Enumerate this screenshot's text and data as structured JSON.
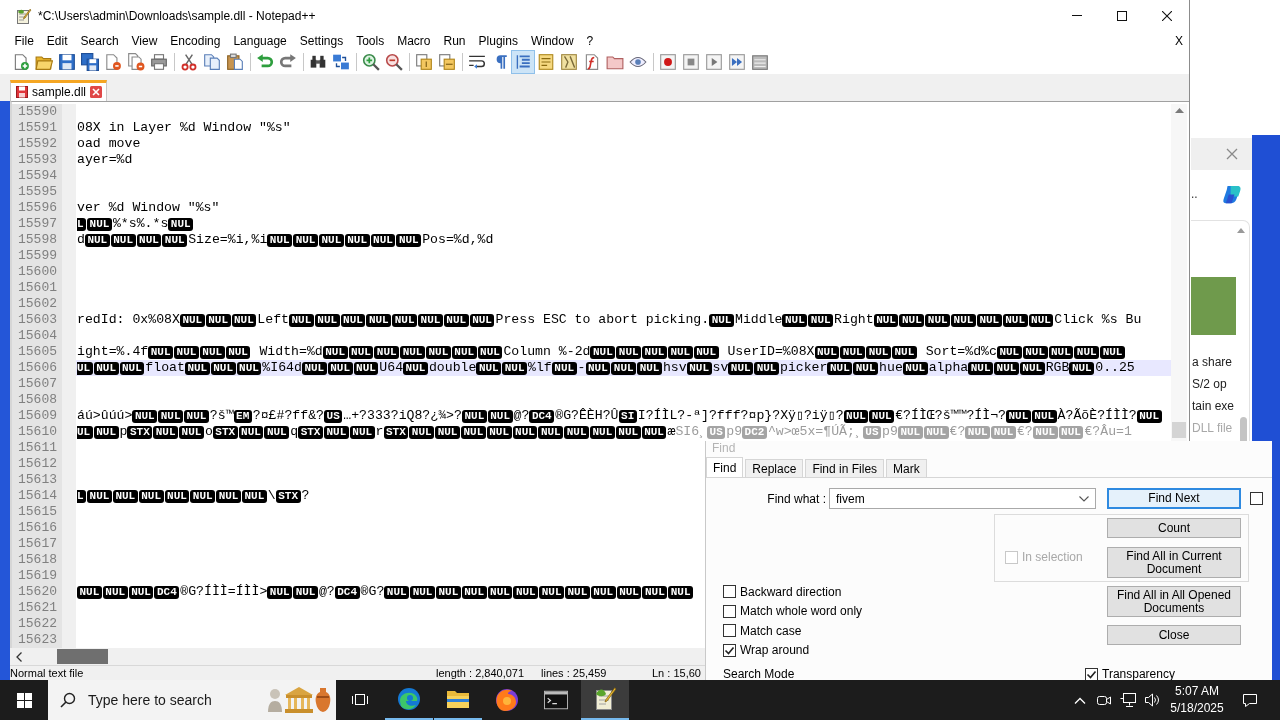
{
  "window": {
    "title": "*C:\\Users\\admin\\Downloads\\sample.dll - Notepad++"
  },
  "menu_bar": {
    "items": [
      "File",
      "Edit",
      "Search",
      "View",
      "Encoding",
      "Language",
      "Settings",
      "Tools",
      "Macro",
      "Run",
      "Plugins",
      "Window",
      "?"
    ],
    "close_label": "X"
  },
  "toolbar": [
    [
      {
        "pressed": false
      },
      {
        "pressed": false
      },
      {
        "pressed": false
      },
      {
        "pressed": false
      },
      {
        "pressed": false
      },
      {
        "pressed": false
      },
      {
        "pressed": false
      }
    ],
    [
      {
        "pressed": false
      },
      {
        "pressed": false
      },
      {
        "pressed": false
      }
    ],
    [
      {
        "pressed": false
      },
      {
        "pressed": false
      }
    ],
    [
      {
        "pressed": false
      },
      {
        "pressed": false
      }
    ],
    [
      {
        "pressed": false
      },
      {
        "pressed": false
      }
    ],
    [
      {
        "pressed": false
      },
      {
        "pressed": false
      }
    ],
    [
      {
        "pressed": false
      },
      {
        "pressed": false
      },
      {
        "pressed": true
      },
      {
        "pressed": false
      },
      {
        "pressed": false
      },
      {
        "pressed": false
      },
      {
        "pressed": false
      },
      {
        "pressed": false
      }
    ],
    [
      {
        "pressed": false
      },
      {
        "pressed": false
      },
      {
        "pressed": false
      },
      {
        "pressed": false
      },
      {
        "pressed": false
      }
    ]
  ],
  "tabs": [
    {
      "label": "sample.dll",
      "selected": true
    }
  ],
  "editor": {
    "lines": [
      {
        "number": "15590",
        "current": false
      },
      {
        "number": "15591",
        "current": false,
        "segments": [
          {
            "kind": "text",
            "text": "08X in Layer %d Window \"%s\""
          }
        ]
      },
      {
        "number": "15592",
        "current": false,
        "segments": [
          {
            "kind": "text",
            "text": "oad move"
          }
        ]
      },
      {
        "number": "15593",
        "current": false,
        "segments": [
          {
            "kind": "text",
            "text": "ayer=%d"
          }
        ]
      },
      {
        "number": "15594",
        "current": false
      },
      {
        "number": "15595",
        "current": false
      },
      {
        "number": "15596",
        "current": false,
        "segments": [
          {
            "kind": "text",
            "text": "ver %d Window \"%s\""
          }
        ]
      },
      {
        "number": "15597",
        "current": false,
        "segments": [
          {
            "kind": "ctrl-cut",
            "text": "L"
          },
          {
            "kind": "ctrl",
            "text": "NUL"
          },
          {
            "kind": "text",
            "text": "%*s%.*s"
          },
          {
            "kind": "ctrl",
            "text": "NUL"
          }
        ]
      },
      {
        "number": "15598",
        "current": false,
        "segments": [
          {
            "kind": "text",
            "text": "d"
          },
          {
            "kind": "ctrl",
            "text": "NUL"
          },
          {
            "kind": "ctrl",
            "text": "NUL"
          },
          {
            "kind": "ctrl",
            "text": "NUL"
          },
          {
            "kind": "ctrl",
            "text": "NUL"
          },
          {
            "kind": "text",
            "text": "Size=%i,%i"
          },
          {
            "kind": "ctrl",
            "text": "NUL"
          },
          {
            "kind": "ctrl",
            "text": "NUL"
          },
          {
            "kind": "ctrl",
            "text": "NUL"
          },
          {
            "kind": "ctrl",
            "text": "NUL"
          },
          {
            "kind": "ctrl",
            "text": "NUL"
          },
          {
            "kind": "ctrl",
            "text": "NUL"
          },
          {
            "kind": "text",
            "text": "Pos=%d,%d"
          }
        ]
      },
      {
        "number": "15599",
        "current": false
      },
      {
        "number": "15600",
        "current": false
      },
      {
        "number": "15601",
        "current": false
      },
      {
        "number": "15602",
        "current": false
      },
      {
        "number": "15603",
        "current": false,
        "segments": [
          {
            "kind": "text",
            "text": "redId: 0x%08X"
          },
          {
            "kind": "ctrl",
            "text": "NUL"
          },
          {
            "kind": "ctrl",
            "text": "NUL"
          },
          {
            "kind": "ctrl",
            "text": "NUL"
          },
          {
            "kind": "text",
            "text": "Left"
          },
          {
            "kind": "ctrl",
            "text": "NUL"
          },
          {
            "kind": "ctrl",
            "text": "NUL"
          },
          {
            "kind": "ctrl",
            "text": "NUL"
          },
          {
            "kind": "ctrl",
            "text": "NUL"
          },
          {
            "kind": "ctrl",
            "text": "NUL"
          },
          {
            "kind": "ctrl",
            "text": "NUL"
          },
          {
            "kind": "ctrl",
            "text": "NUL"
          },
          {
            "kind": "ctrl",
            "text": "NUL"
          },
          {
            "kind": "text",
            "text": "Press ESC to abort picking."
          },
          {
            "kind": "ctrl",
            "text": "NUL"
          },
          {
            "kind": "text",
            "text": "Middle"
          },
          {
            "kind": "ctrl",
            "text": "NUL"
          },
          {
            "kind": "ctrl",
            "text": "NUL"
          },
          {
            "kind": "text",
            "text": "Right"
          },
          {
            "kind": "ctrl",
            "text": "NUL"
          },
          {
            "kind": "ctrl",
            "text": "NUL"
          },
          {
            "kind": "ctrl",
            "text": "NUL"
          },
          {
            "kind": "ctrl",
            "text": "NUL"
          },
          {
            "kind": "ctrl",
            "text": "NUL"
          },
          {
            "kind": "ctrl",
            "text": "NUL"
          },
          {
            "kind": "ctrl",
            "text": "NUL"
          },
          {
            "kind": "text",
            "text": "Click %s Bu"
          }
        ]
      },
      {
        "number": "15604",
        "current": false
      },
      {
        "number": "15605",
        "current": false,
        "segments": [
          {
            "kind": "text",
            "text": "ight=%.4f"
          },
          {
            "kind": "ctrl",
            "text": "NUL"
          },
          {
            "kind": "ctrl",
            "text": "NUL"
          },
          {
            "kind": "ctrl",
            "text": "NUL"
          },
          {
            "kind": "ctrl",
            "text": "NUL"
          },
          {
            "kind": "text",
            "text": " Width=%d"
          },
          {
            "kind": "ctrl",
            "text": "NUL"
          },
          {
            "kind": "ctrl",
            "text": "NUL"
          },
          {
            "kind": "ctrl",
            "text": "NUL"
          },
          {
            "kind": "ctrl",
            "text": "NUL"
          },
          {
            "kind": "ctrl",
            "text": "NUL"
          },
          {
            "kind": "ctrl",
            "text": "NUL"
          },
          {
            "kind": "ctrl",
            "text": "NUL"
          },
          {
            "kind": "text",
            "text": "Column %-2d"
          },
          {
            "kind": "ctrl",
            "text": "NUL"
          },
          {
            "kind": "ctrl",
            "text": "NUL"
          },
          {
            "kind": "ctrl",
            "text": "NUL"
          },
          {
            "kind": "ctrl",
            "text": "NUL"
          },
          {
            "kind": "ctrl",
            "text": "NUL"
          },
          {
            "kind": "text",
            "text": " UserID=%08X"
          },
          {
            "kind": "ctrl",
            "text": "NUL"
          },
          {
            "kind": "ctrl",
            "text": "NUL"
          },
          {
            "kind": "ctrl",
            "text": "NUL"
          },
          {
            "kind": "ctrl",
            "text": "NUL"
          },
          {
            "kind": "text",
            "text": " Sort=%d%c"
          },
          {
            "kind": "ctrl",
            "text": "NUL"
          },
          {
            "kind": "ctrl",
            "text": "NUL"
          },
          {
            "kind": "ctrl",
            "text": "NUL"
          },
          {
            "kind": "ctrl",
            "text": "NUL"
          },
          {
            "kind": "ctrl",
            "text": "NUL"
          }
        ]
      },
      {
        "number": "15606",
        "current": true,
        "segments": [
          {
            "kind": "ctrl-cut",
            "text": "UL"
          },
          {
            "kind": "ctrl",
            "text": "NUL"
          },
          {
            "kind": "ctrl",
            "text": "NUL"
          },
          {
            "kind": "text",
            "text": "float"
          },
          {
            "kind": "ctrl",
            "text": "NUL"
          },
          {
            "kind": "ctrl",
            "text": "NUL"
          },
          {
            "kind": "ctrl",
            "text": "NUL"
          },
          {
            "kind": "text",
            "text": "%I64d"
          },
          {
            "kind": "ctrl",
            "text": "NUL"
          },
          {
            "kind": "ctrl",
            "text": "NUL"
          },
          {
            "kind": "ctrl",
            "text": "NUL"
          },
          {
            "kind": "text",
            "text": "U64"
          },
          {
            "kind": "ctrl",
            "text": "NUL"
          },
          {
            "kind": "text",
            "text": "double"
          },
          {
            "kind": "ctrl",
            "text": "NUL"
          },
          {
            "kind": "ctrl",
            "text": "NUL"
          },
          {
            "kind": "text",
            "text": "%lf"
          },
          {
            "kind": "ctrl",
            "text": "NUL"
          },
          {
            "kind": "text",
            "text": "-"
          },
          {
            "kind": "ctrl",
            "text": "NUL"
          },
          {
            "kind": "ctrl",
            "text": "NUL"
          },
          {
            "kind": "ctrl",
            "text": "NUL"
          },
          {
            "kind": "text",
            "text": "hsv"
          },
          {
            "kind": "ctrl",
            "text": "NUL"
          },
          {
            "kind": "text",
            "text": "sv"
          },
          {
            "kind": "ctrl",
            "text": "NUL"
          },
          {
            "kind": "ctrl",
            "text": "NUL"
          },
          {
            "kind": "text",
            "text": "picker"
          },
          {
            "kind": "ctrl",
            "text": "NUL"
          },
          {
            "kind": "ctrl",
            "text": "NUL"
          },
          {
            "kind": "text",
            "text": "hue"
          },
          {
            "kind": "ctrl",
            "text": "NUL"
          },
          {
            "kind": "text",
            "text": "alpha"
          },
          {
            "kind": "ctrl",
            "text": "NUL"
          },
          {
            "kind": "ctrl",
            "text": "NUL"
          },
          {
            "kind": "ctrl",
            "text": "NUL"
          },
          {
            "kind": "text",
            "text": "RGB"
          },
          {
            "kind": "ctrl",
            "text": "NUL"
          },
          {
            "kind": "text",
            "text": "0..25"
          }
        ]
      },
      {
        "number": "15607",
        "current": false
      },
      {
        "number": "15608",
        "current": false
      },
      {
        "number": "15609",
        "current": false,
        "segments": [
          {
            "kind": "text",
            "text": "áú>ûúú>"
          },
          {
            "kind": "ctrl",
            "text": "NUL"
          },
          {
            "kind": "ctrl",
            "text": "NUL"
          },
          {
            "kind": "ctrl",
            "text": "NUL"
          },
          {
            "kind": "text",
            "text": "?š™"
          },
          {
            "kind": "ctrl",
            "text": "EM"
          },
          {
            "kind": "text",
            "text": "?¤£#?ff&?"
          },
          {
            "kind": "ctrl",
            "text": "US"
          },
          {
            "kind": "text",
            "text": "…+?333?iQ8?¿¾>?"
          },
          {
            "kind": "ctrl",
            "text": "NUL"
          },
          {
            "kind": "ctrl",
            "text": "NUL"
          },
          {
            "kind": "text",
            "text": "@?"
          },
          {
            "kind": "ctrl",
            "text": "DC4"
          },
          {
            "kind": "text",
            "text": "®G?ÊÈH?Û"
          },
          {
            "kind": "ctrl",
            "text": "SI"
          },
          {
            "kind": "text",
            "text": "I?ÍÌL?-ª]?fff?¤p}?Xÿ▯?iÿ▯?"
          },
          {
            "kind": "ctrl",
            "text": "NUL"
          },
          {
            "kind": "ctrl",
            "text": "NUL"
          },
          {
            "kind": "text",
            "text": "€?ÍÌŒ?š™™?ÍÌ¬?"
          },
          {
            "kind": "ctrl",
            "text": "NUL"
          },
          {
            "kind": "ctrl",
            "text": "NUL"
          },
          {
            "kind": "text",
            "text": "À?ÃõÈ?ÍÌÌ?"
          },
          {
            "kind": "ctrl",
            "text": "NUL"
          }
        ]
      },
      {
        "number": "15610",
        "current": false,
        "segments": [
          {
            "kind": "ctrl-cut",
            "text": "UL"
          },
          {
            "kind": "ctrl",
            "text": "NUL"
          },
          {
            "kind": "text",
            "text": "p"
          },
          {
            "kind": "ctrl",
            "text": "STX"
          },
          {
            "kind": "ctrl",
            "text": "NUL"
          },
          {
            "kind": "ctrl",
            "text": "NUL"
          },
          {
            "kind": "text",
            "text": "o"
          },
          {
            "kind": "ctrl",
            "text": "STX"
          },
          {
            "kind": "ctrl",
            "text": "NUL"
          },
          {
            "kind": "ctrl",
            "text": "NUL"
          },
          {
            "kind": "text",
            "text": "q"
          },
          {
            "kind": "ctrl",
            "text": "STX"
          },
          {
            "kind": "ctrl",
            "text": "NUL"
          },
          {
            "kind": "ctrl",
            "text": "NUL"
          },
          {
            "kind": "text",
            "text": "r"
          },
          {
            "kind": "ctrl",
            "text": "STX"
          },
          {
            "kind": "ctrl",
            "text": "NUL"
          },
          {
            "kind": "ctrl",
            "text": "NUL"
          },
          {
            "kind": "ctrl",
            "text": "NUL"
          },
          {
            "kind": "ctrl",
            "text": "NUL"
          },
          {
            "kind": "ctrl",
            "text": "NUL"
          },
          {
            "kind": "ctrl",
            "text": "NUL"
          },
          {
            "kind": "ctrl",
            "text": "NUL"
          },
          {
            "kind": "ctrl",
            "text": "NUL"
          },
          {
            "kind": "ctrl",
            "text": "NUL"
          },
          {
            "kind": "ctrl",
            "text": "NUL"
          },
          {
            "kind": "text",
            "text": "æ"
          },
          {
            "kind": "faded-text",
            "text": "SI6¸"
          },
          {
            "kind": "faded-ctrl",
            "text": "US"
          },
          {
            "kind": "faded-text",
            "text": "p9"
          },
          {
            "kind": "faded-ctrl",
            "text": "DC2"
          },
          {
            "kind": "faded-text",
            "text": "^w>œ5x=¶ÚÃ;¸"
          },
          {
            "kind": "faded-ctrl",
            "text": "US"
          },
          {
            "kind": "faded-text",
            "text": "p9"
          },
          {
            "kind": "faded-ctrl",
            "text": "NUL"
          },
          {
            "kind": "faded-ctrl",
            "text": "NUL"
          },
          {
            "kind": "faded-text",
            "text": "€?"
          },
          {
            "kind": "faded-ctrl",
            "text": "NUL"
          },
          {
            "kind": "faded-ctrl",
            "text": "NUL"
          },
          {
            "kind": "faded-text",
            "text": "€?"
          },
          {
            "kind": "faded-ctrl",
            "text": "NUL"
          },
          {
            "kind": "faded-ctrl",
            "text": "NUL"
          },
          {
            "kind": "faded-text",
            "text": "€?Âu=1"
          }
        ]
      },
      {
        "number": "15611",
        "current": false
      },
      {
        "number": "15612",
        "current": false
      },
      {
        "number": "15613",
        "current": false
      },
      {
        "number": "15614",
        "current": false,
        "segments": [
          {
            "kind": "ctrl-cut",
            "text": "L"
          },
          {
            "kind": "ctrl",
            "text": "NUL"
          },
          {
            "kind": "ctrl",
            "text": "NUL"
          },
          {
            "kind": "ctrl",
            "text": "NUL"
          },
          {
            "kind": "ctrl",
            "text": "NUL"
          },
          {
            "kind": "ctrl",
            "text": "NUL"
          },
          {
            "kind": "ctrl",
            "text": "NUL"
          },
          {
            "kind": "ctrl",
            "text": "NUL"
          },
          {
            "kind": "text",
            "text": "\\"
          },
          {
            "kind": "ctrl",
            "text": "STX"
          },
          {
            "kind": "text",
            "text": "?"
          }
        ]
      },
      {
        "number": "15615",
        "current": false
      },
      {
        "number": "15616",
        "current": false
      },
      {
        "number": "15617",
        "current": false
      },
      {
        "number": "15618",
        "current": false
      },
      {
        "number": "15619",
        "current": false
      },
      {
        "number": "15620",
        "current": false,
        "segments": [
          {
            "kind": "ctrl",
            "text": "NUL"
          },
          {
            "kind": "ctrl",
            "text": "NUL"
          },
          {
            "kind": "ctrl",
            "text": "NUL"
          },
          {
            "kind": "ctrl",
            "text": "DC4"
          },
          {
            "kind": "text",
            "text": "®G?ÍÌÌ=ÍÌÌ>"
          },
          {
            "kind": "ctrl",
            "text": "NUL"
          },
          {
            "kind": "ctrl",
            "text": "NUL"
          },
          {
            "kind": "text",
            "text": "@?"
          },
          {
            "kind": "ctrl",
            "text": "DC4"
          },
          {
            "kind": "text",
            "text": "®G?"
          },
          {
            "kind": "ctrl",
            "text": "NUL"
          },
          {
            "kind": "ctrl",
            "text": "NUL"
          },
          {
            "kind": "ctrl",
            "text": "NUL"
          },
          {
            "kind": "ctrl",
            "text": "NUL"
          },
          {
            "kind": "ctrl",
            "text": "NUL"
          },
          {
            "kind": "ctrl",
            "text": "NUL"
          },
          {
            "kind": "ctrl",
            "text": "NUL"
          },
          {
            "kind": "ctrl",
            "text": "NUL"
          },
          {
            "kind": "ctrl",
            "text": "NUL"
          },
          {
            "kind": "ctrl",
            "text": "NUL"
          },
          {
            "kind": "ctrl",
            "text": "NUL"
          },
          {
            "kind": "ctrl",
            "text": "NUL"
          }
        ]
      },
      {
        "number": "15621",
        "current": false
      },
      {
        "number": "15622",
        "current": false
      },
      {
        "number": "15623",
        "current": false
      }
    ]
  },
  "status_bar": [
    "Normal text file",
    "length : 2,840,071",
    "lines : 25,459",
    "Ln : 15,60"
  ],
  "find_dialog": {
    "title": "Find",
    "tabs": [
      {
        "label": "Find",
        "selected": true
      },
      {
        "label": "Replace",
        "selected": false
      },
      {
        "label": "Find in Files",
        "selected": false
      },
      {
        "label": "Mark",
        "selected": false
      }
    ],
    "find_what": {
      "label": "Find what :",
      "value": "fivem"
    },
    "side_checkbox": {
      "checked": false
    },
    "buttons": [
      {
        "label": "Find Next",
        "focused": true
      },
      {
        "label": "Count",
        "focused": false
      },
      {
        "label": "Find All in Current Document",
        "focused": false
      },
      {
        "label": "Find All in All Opened Documents",
        "focused": false
      },
      {
        "label": "Close",
        "focused": false
      }
    ],
    "in_selection": {
      "label": "In selection",
      "checked": false,
      "disabled": true
    },
    "options": [
      {
        "label": "Backward direction",
        "checked": false
      },
      {
        "label": "Match whole word only",
        "checked": false
      },
      {
        "label": "Match case",
        "checked": false
      },
      {
        "label": "Wrap around",
        "checked": true
      }
    ],
    "search_mode_label": "Search Mode",
    "transparency": {
      "label": "Transparency",
      "checked": true
    }
  },
  "background_window": {
    "dots": "..",
    "lines": [
      {
        "kind": "normal",
        "text": "a share"
      },
      {
        "kind": "normal",
        "text": "S/2 op"
      },
      {
        "kind": "normal",
        "text": "tain exe"
      },
      {
        "kind": "faded",
        "text": "DLL file"
      }
    ]
  },
  "taskbar": {
    "search": {
      "placeholder": "Type here to search"
    },
    "apps": [
      {
        "running": true,
        "selected": false
      },
      {
        "running": true,
        "selected": false
      },
      {
        "running": false,
        "selected": false
      },
      {
        "running": false,
        "selected": false
      },
      {
        "running": true,
        "selected": true
      }
    ],
    "clock": {
      "time": "5:07 AM",
      "date": "5/18/2025"
    }
  }
}
